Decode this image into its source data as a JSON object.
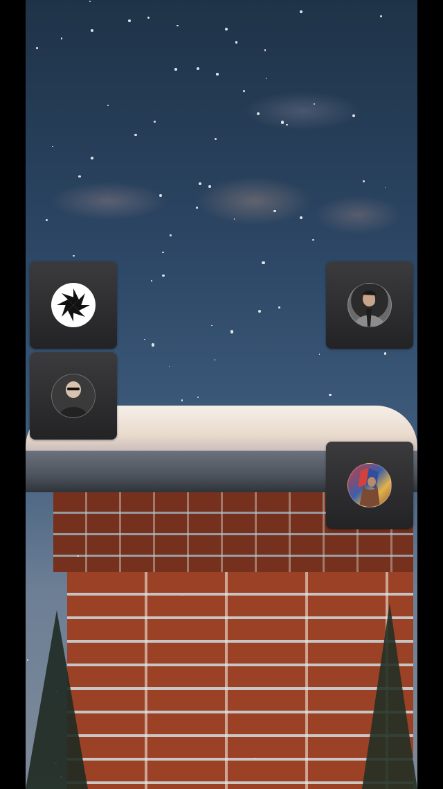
{
  "scene": {
    "description_icons": [
      "snowflake-icon"
    ]
  },
  "participants": [
    {
      "id": "tile-1",
      "avatar_icon": "pinwheel-logo-icon",
      "name": ""
    },
    {
      "id": "tile-2",
      "avatar_icon": "user-avatar-icon",
      "name": ""
    },
    {
      "id": "tile-3",
      "avatar_icon": "user-avatar-icon",
      "name": ""
    },
    {
      "id": "tile-4",
      "avatar_icon": "user-avatar-icon",
      "name": ""
    }
  ],
  "colors": {
    "tile_bg": "#2e2e30",
    "brick": "#9b4126",
    "sky": "#2b4563"
  }
}
